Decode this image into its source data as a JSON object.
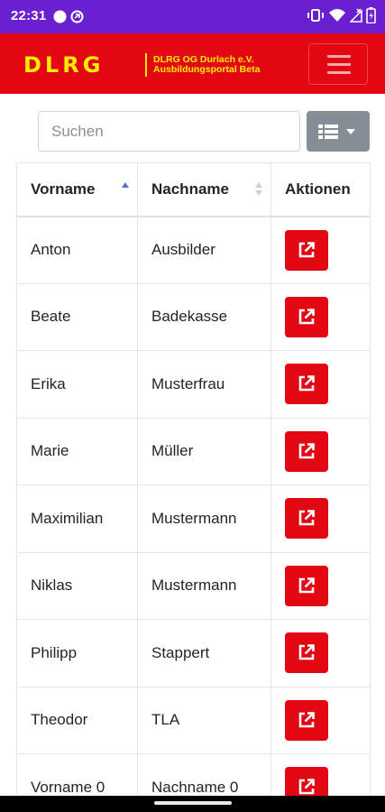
{
  "status_bar": {
    "time": "22:31",
    "left_icons": [
      "circle-notification-icon",
      "data-saver-icon"
    ],
    "right_icons": [
      "vibrate-icon",
      "wifi-icon",
      "no-signal-icon",
      "battery-icon"
    ]
  },
  "navbar": {
    "logo_text": "DLRG",
    "brand_line1": "DLRG OG Durlach e.V.",
    "brand_line2": "Ausbildungsportal Beta",
    "menu_icon": "hamburger-icon",
    "colors": {
      "background": "#e30613",
      "brand": "#ffed00"
    }
  },
  "search": {
    "placeholder": "Suchen",
    "value": ""
  },
  "columns_button": {
    "icon": "list-icon",
    "dropdown": "caret-down-icon"
  },
  "table": {
    "headers": {
      "first": "Vorname",
      "last": "Nachname",
      "actions": "Aktionen"
    },
    "sort": {
      "column": "Vorname",
      "direction": "ascending"
    },
    "rows": [
      {
        "first": "Anton",
        "last": "Ausbilder"
      },
      {
        "first": "Beate",
        "last": "Badekasse"
      },
      {
        "first": "Erika",
        "last": "Musterfrau"
      },
      {
        "first": "Marie",
        "last": "Müller"
      },
      {
        "first": "Maximilian",
        "last": "Mustermann"
      },
      {
        "first": "Niklas",
        "last": "Mustermann"
      },
      {
        "first": "Philipp",
        "last": "Stappert"
      },
      {
        "first": "Theodor",
        "last": "TLA"
      },
      {
        "first": "Vorname 0",
        "last": "Nachname 0"
      }
    ],
    "row_action_icon": "external-link-icon",
    "colors": {
      "action": "#e30613",
      "sort_active": "#5b6ec6"
    }
  }
}
